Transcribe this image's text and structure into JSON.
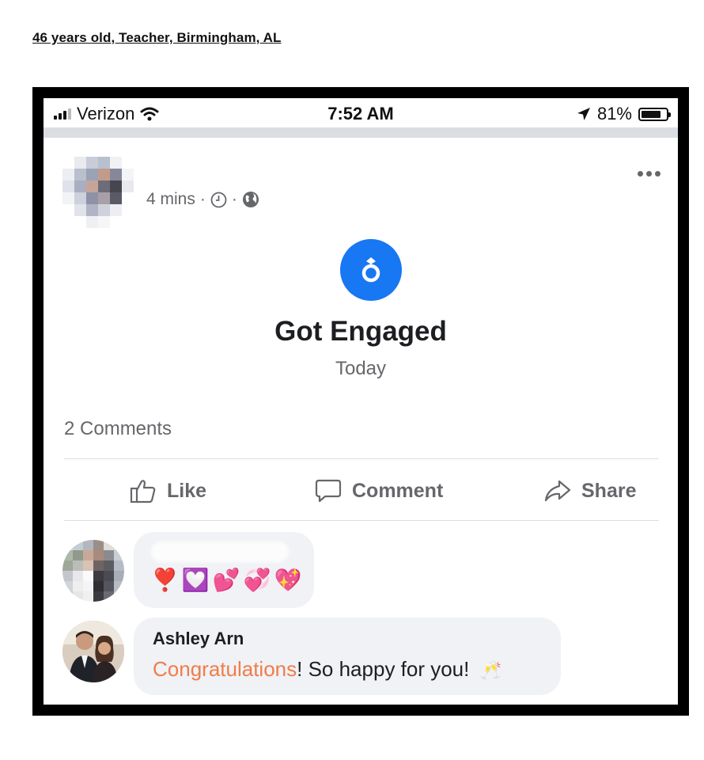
{
  "caption": "46 years old, Teacher, Birmingham, AL",
  "status_bar": {
    "carrier": "Verizon",
    "time": "7:52 AM",
    "battery": "81%",
    "battery_level": 0.81,
    "icons": [
      "signal-bars-icon",
      "wifi-icon",
      "location-arrow-icon",
      "battery-icon"
    ]
  },
  "post": {
    "time_ago": "4 mins",
    "separator": "·",
    "icons": [
      "clock-icon",
      "globe-icon",
      "more-options-icon"
    ],
    "life_event": {
      "icon": "ring-icon",
      "icon_color": "#1877f2",
      "title": "Got Engaged",
      "date": "Today"
    },
    "comments_count": "2 Comments",
    "actions": {
      "like": "Like",
      "comment": "Comment",
      "share": "Share"
    }
  },
  "comments": [
    {
      "author": "",
      "emojis": [
        "❣️",
        "💟",
        "💕",
        "💞",
        "💖"
      ]
    },
    {
      "author": "Ashley Arn",
      "highlight": "Congratulations",
      "text": "! So happy for you!",
      "emoji": "🥂",
      "highlight_color": "#f07c4a"
    }
  ]
}
